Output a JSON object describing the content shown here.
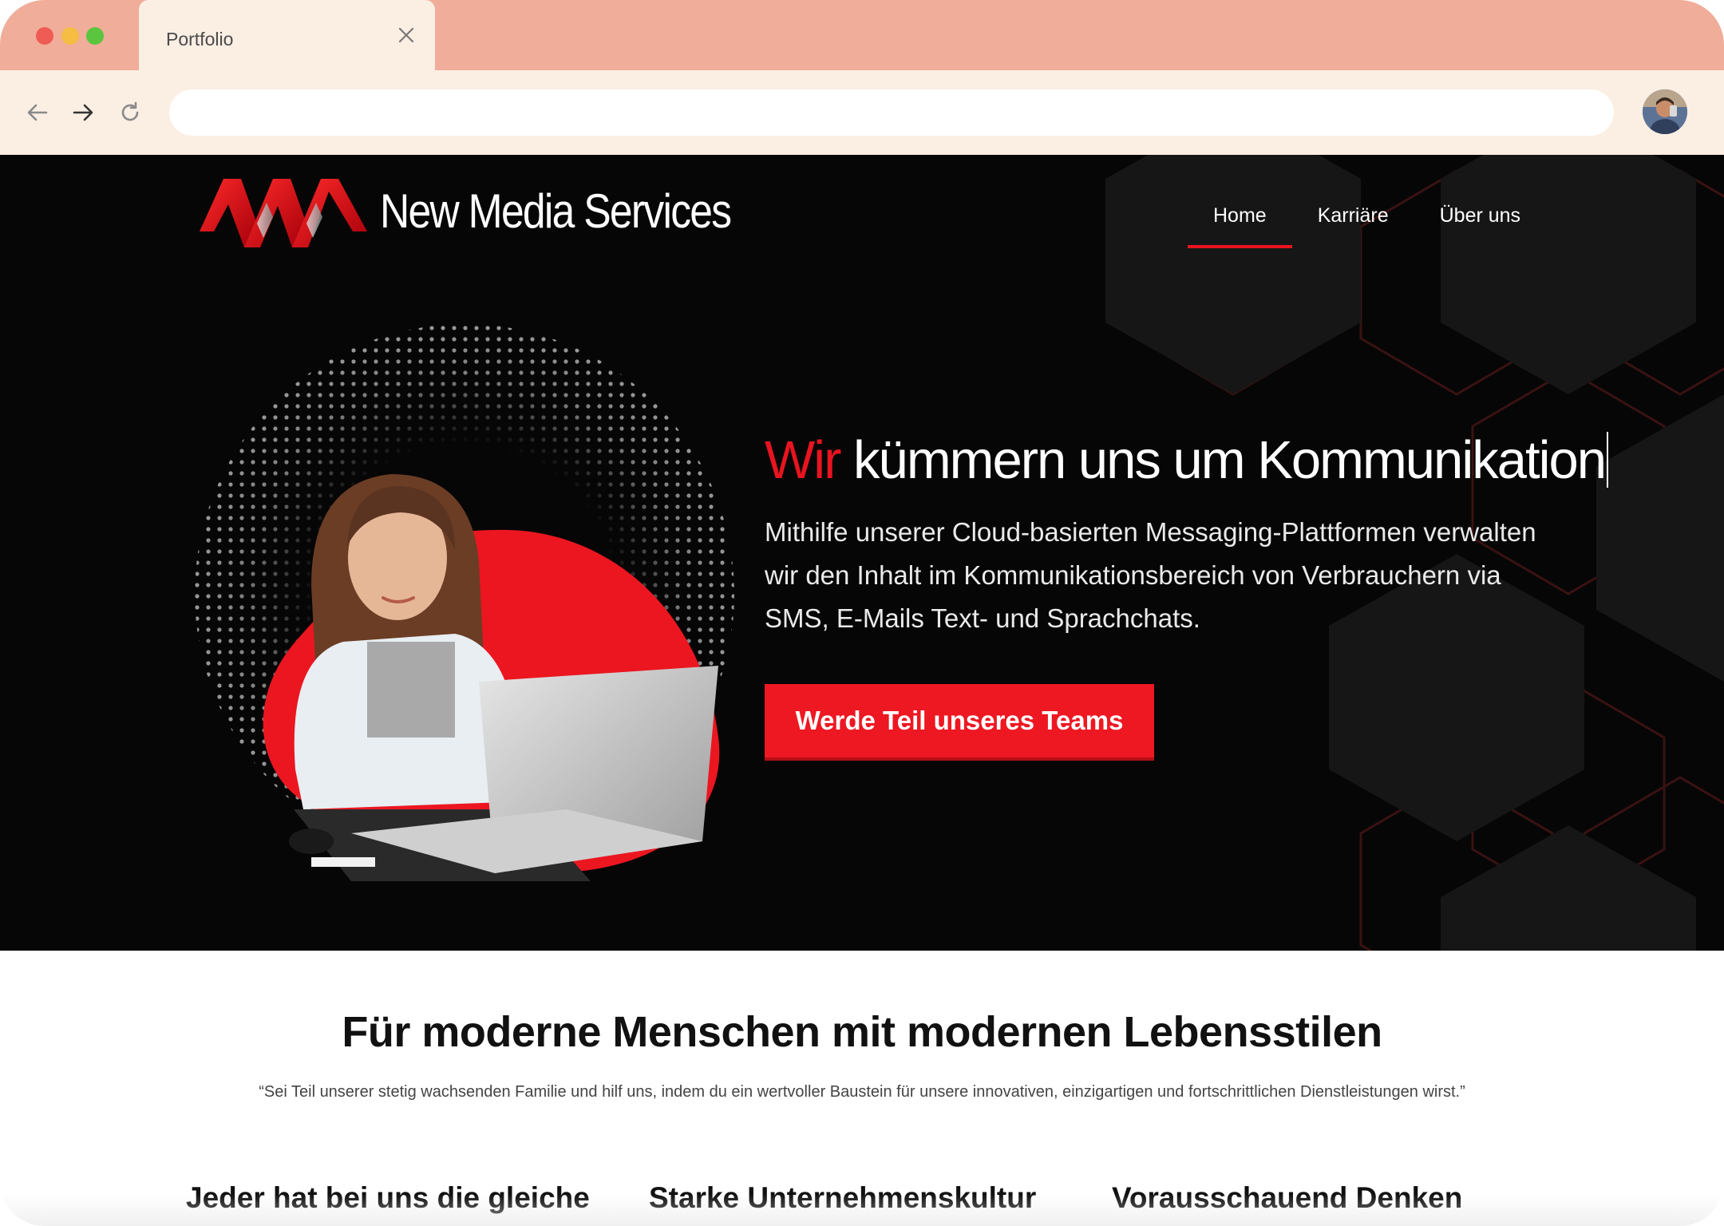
{
  "browser": {
    "tab_title": "Portfolio",
    "address_value": "",
    "titlebar_color": "#f0ad99",
    "toolbar_color": "#fbeee3"
  },
  "site": {
    "brand": "New Media Services",
    "accent_color": "#e8141f",
    "nav": {
      "items": [
        {
          "label": "Home",
          "active": true
        },
        {
          "label": "Karriäre",
          "active": false
        },
        {
          "label": "Über uns",
          "active": false
        }
      ]
    },
    "hero": {
      "headline_accent": "Wir",
      "headline_rest": " kümmern uns um Kommunikation",
      "subtext": "Mithilfe unserer Cloud-basierten Messaging-Plattformen verwalten wir den Inhalt im Kommunikationsbereich von Verbrauchern via SMS, E-Mails Text- und Sprachchats.",
      "cta_label": "Werde Teil unseres Teams"
    },
    "section": {
      "title": "Für moderne Menschen mit modernen Lebensstilen",
      "quote": "“Sei Teil unserer stetig wachsenden Familie und hilf uns, indem du ein wertvoller Baustein für unsere innovativen, einzigartigen und fortschrittlichen Dienstleistungen wirst.”",
      "features": [
        {
          "title": "Jeder hat bei uns die gleiche"
        },
        {
          "title": "Starke Unternehmenskultur"
        },
        {
          "title": "Vorausschauend Denken"
        }
      ]
    }
  }
}
